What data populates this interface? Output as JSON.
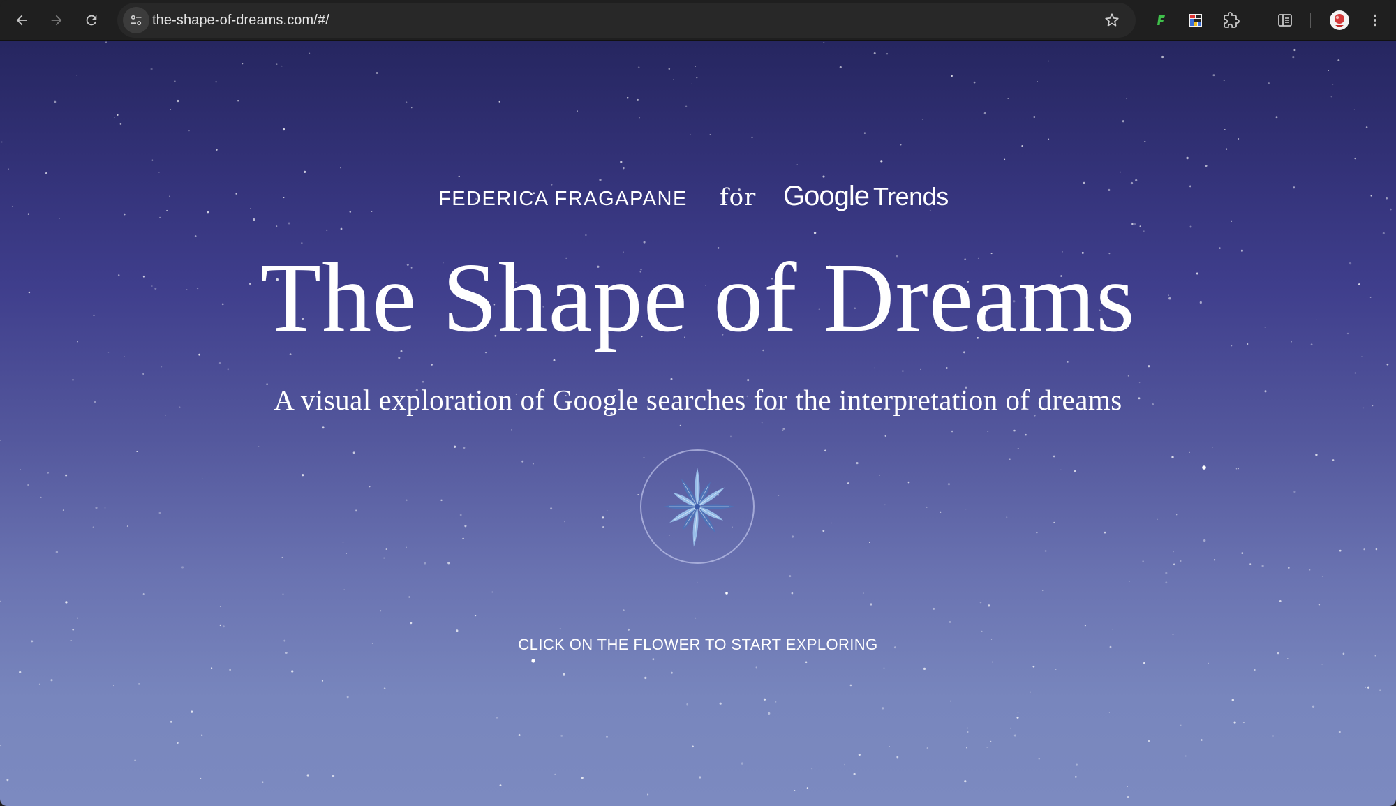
{
  "browser": {
    "url": "the-shape-of-dreams.com/#/",
    "icons": {
      "back": "arrow-left-icon",
      "forward": "arrow-right-icon",
      "reload": "reload-icon",
      "site_info": "tune-icon",
      "bookmark": "star-icon",
      "extensions": [
        "extension-green-icon",
        "extension-grid-icon",
        "puzzle-icon"
      ],
      "side_panel": "side-panel-icon",
      "profile": "avatar",
      "menu": "kebab-menu-icon"
    }
  },
  "page": {
    "author": "FEDERICA FRAGAPANE",
    "for_word": "for",
    "brand_google": "Google",
    "brand_trends": "Trends",
    "title": "The Shape of Dreams",
    "subtitle": "A visual exploration of Google searches for the interpretation of dreams",
    "cta": "CLICK ON THE FLOWER TO START EXPLORING"
  },
  "colors": {
    "sky_top": "#262660",
    "sky_mid": "#3f3e8c",
    "sky_bottom": "#7c8ac0",
    "text": "#ffffff",
    "flower_petal": "#9cc4ee",
    "flower_petal_dark": "#4d73b8"
  }
}
